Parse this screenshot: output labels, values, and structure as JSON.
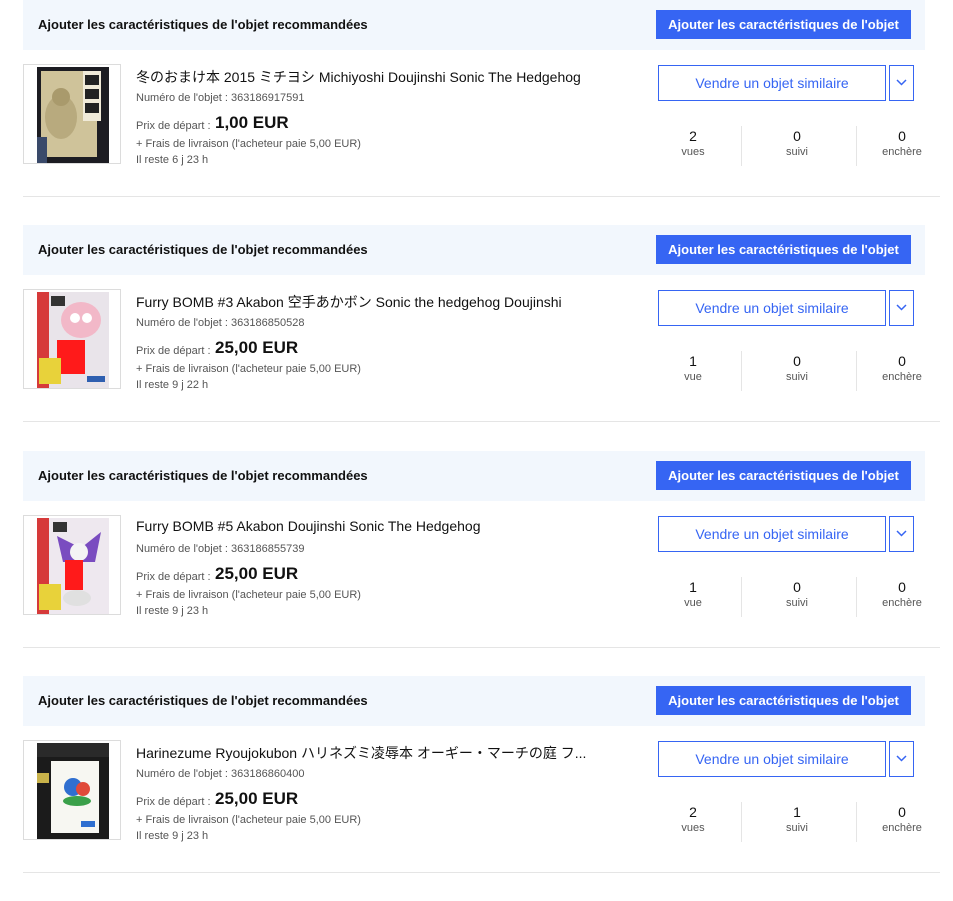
{
  "colors": {
    "accent": "#3665f3",
    "banner_bg": "#f2f7fd"
  },
  "items": [
    {
      "banner_text": "Ajouter les caractéristiques de l'objet recommandées",
      "banner_button": "Ajouter les caractéristiques de l'objet",
      "title": "冬のおまけ本 2015 ミチヨシ Michiyoshi Doujinshi Sonic The Hedgehog",
      "item_number": "Numéro de l'objet : 363186917591",
      "price_label": "Prix de départ :",
      "price": "1,00 EUR",
      "shipping": "+ Frais de livraison (l'acheteur paie 5,00 EUR)",
      "time_left": "Il reste 6 j 23 h",
      "sell_button": "Vendre un objet similaire",
      "dropdown_icon": "chevron-down-icon",
      "stats": {
        "views": "2",
        "views_label": "vues",
        "watchers": "0",
        "watchers_label": "suivi",
        "bids": "0",
        "bids_label": "enchère"
      }
    },
    {
      "banner_text": "Ajouter les caractéristiques de l'objet recommandées",
      "banner_button": "Ajouter les caractéristiques de l'objet",
      "title": "Furry BOMB #3 Akabon 空手あかボン Sonic the hedgehog Doujinshi",
      "item_number": "Numéro de l'objet : 363186850528",
      "price_label": "Prix de départ :",
      "price": "25,00 EUR",
      "shipping": "+ Frais de livraison (l'acheteur paie 5,00 EUR)",
      "time_left": "Il reste 9 j 22 h",
      "sell_button": "Vendre un objet similaire",
      "dropdown_icon": "chevron-down-icon",
      "stats": {
        "views": "1",
        "views_label": "vue",
        "watchers": "0",
        "watchers_label": "suivi",
        "bids": "0",
        "bids_label": "enchère"
      }
    },
    {
      "banner_text": "Ajouter les caractéristiques de l'objet recommandées",
      "banner_button": "Ajouter les caractéristiques de l'objet",
      "title": "Furry BOMB #5 Akabon Doujinshi Sonic The Hedgehog",
      "item_number": "Numéro de l'objet : 363186855739",
      "price_label": "Prix de départ :",
      "price": "25,00 EUR",
      "shipping": "+ Frais de livraison (l'acheteur paie 5,00 EUR)",
      "time_left": "Il reste 9 j 23 h",
      "sell_button": "Vendre un objet similaire",
      "dropdown_icon": "chevron-down-icon",
      "stats": {
        "views": "1",
        "views_label": "vue",
        "watchers": "0",
        "watchers_label": "suivi",
        "bids": "0",
        "bids_label": "enchère"
      }
    },
    {
      "banner_text": "Ajouter les caractéristiques de l'objet recommandées",
      "banner_button": "Ajouter les caractéristiques de l'objet",
      "title": "Harinezume Ryoujokubon ハリネズミ凌辱本 オーギー・マーチの庭 フ...",
      "item_number": "Numéro de l'objet : 363186860400",
      "price_label": "Prix de départ :",
      "price": "25,00 EUR",
      "shipping": "+ Frais de livraison (l'acheteur paie 5,00 EUR)",
      "time_left": "Il reste 9 j 23 h",
      "sell_button": "Vendre un objet similaire",
      "dropdown_icon": "chevron-down-icon",
      "stats": {
        "views": "2",
        "views_label": "vues",
        "watchers": "1",
        "watchers_label": "suivi",
        "bids": "0",
        "bids_label": "enchère"
      }
    }
  ]
}
